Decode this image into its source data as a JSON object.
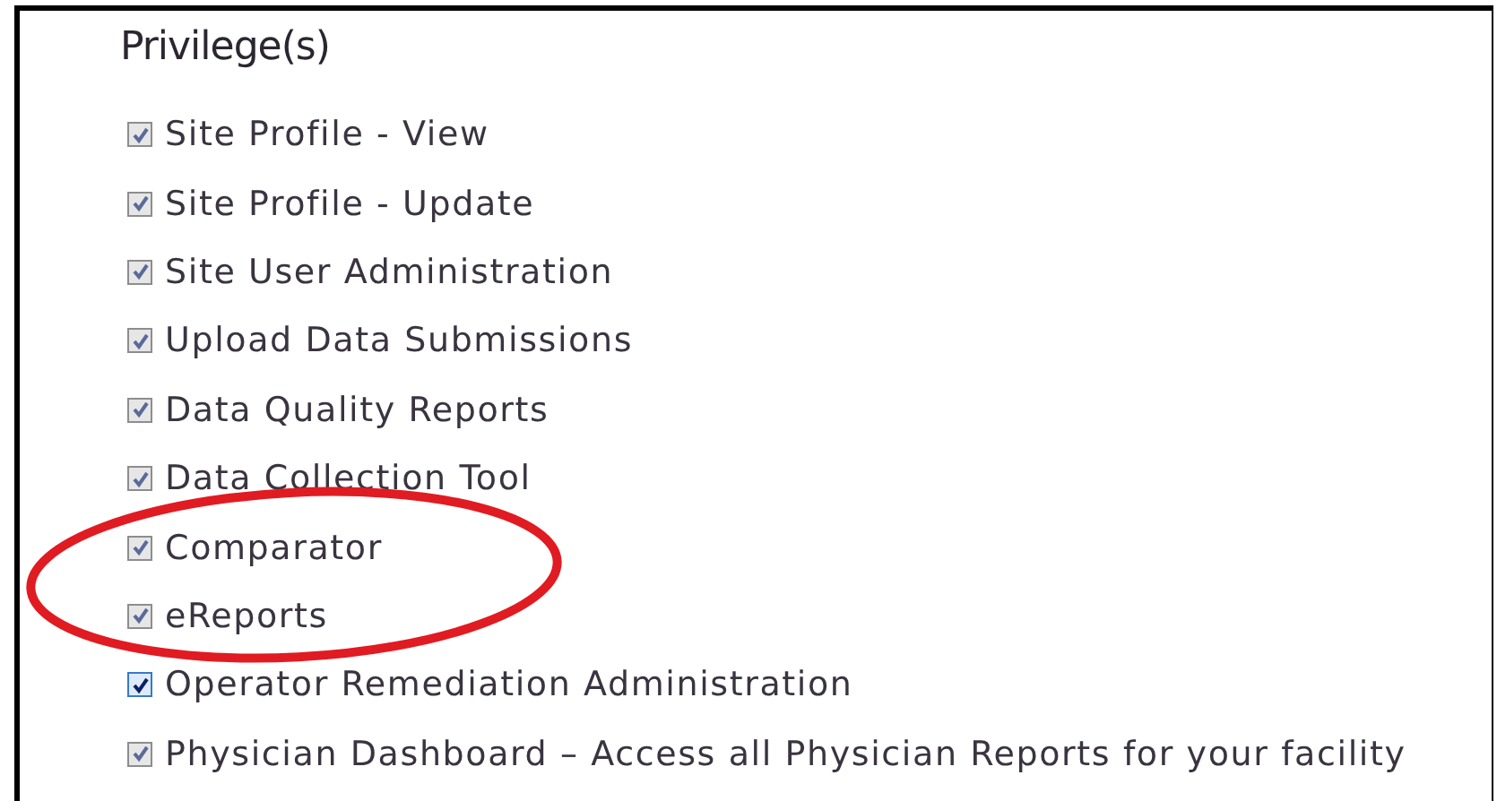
{
  "heading": "Privilege(s)",
  "privileges": [
    {
      "label": "Site Profile - View",
      "checked": true,
      "disabled": true,
      "highlighted": false
    },
    {
      "label": "Site Profile - Update",
      "checked": true,
      "disabled": true,
      "highlighted": false
    },
    {
      "label": "Site User Administration",
      "checked": true,
      "disabled": true,
      "highlighted": false
    },
    {
      "label": "Upload Data Submissions",
      "checked": true,
      "disabled": true,
      "highlighted": false
    },
    {
      "label": "Data Quality Reports",
      "checked": true,
      "disabled": true,
      "highlighted": false
    },
    {
      "label": "Data Collection Tool",
      "checked": true,
      "disabled": true,
      "highlighted": false
    },
    {
      "label": "Comparator",
      "checked": true,
      "disabled": true,
      "highlighted": true
    },
    {
      "label": "eReports",
      "checked": true,
      "disabled": true,
      "highlighted": true
    },
    {
      "label": "Operator Remediation Administration",
      "checked": true,
      "disabled": false,
      "highlighted": false
    },
    {
      "label": "Physician Dashboard – Access all Physician Reports for your facility",
      "checked": true,
      "disabled": true,
      "highlighted": false
    }
  ]
}
